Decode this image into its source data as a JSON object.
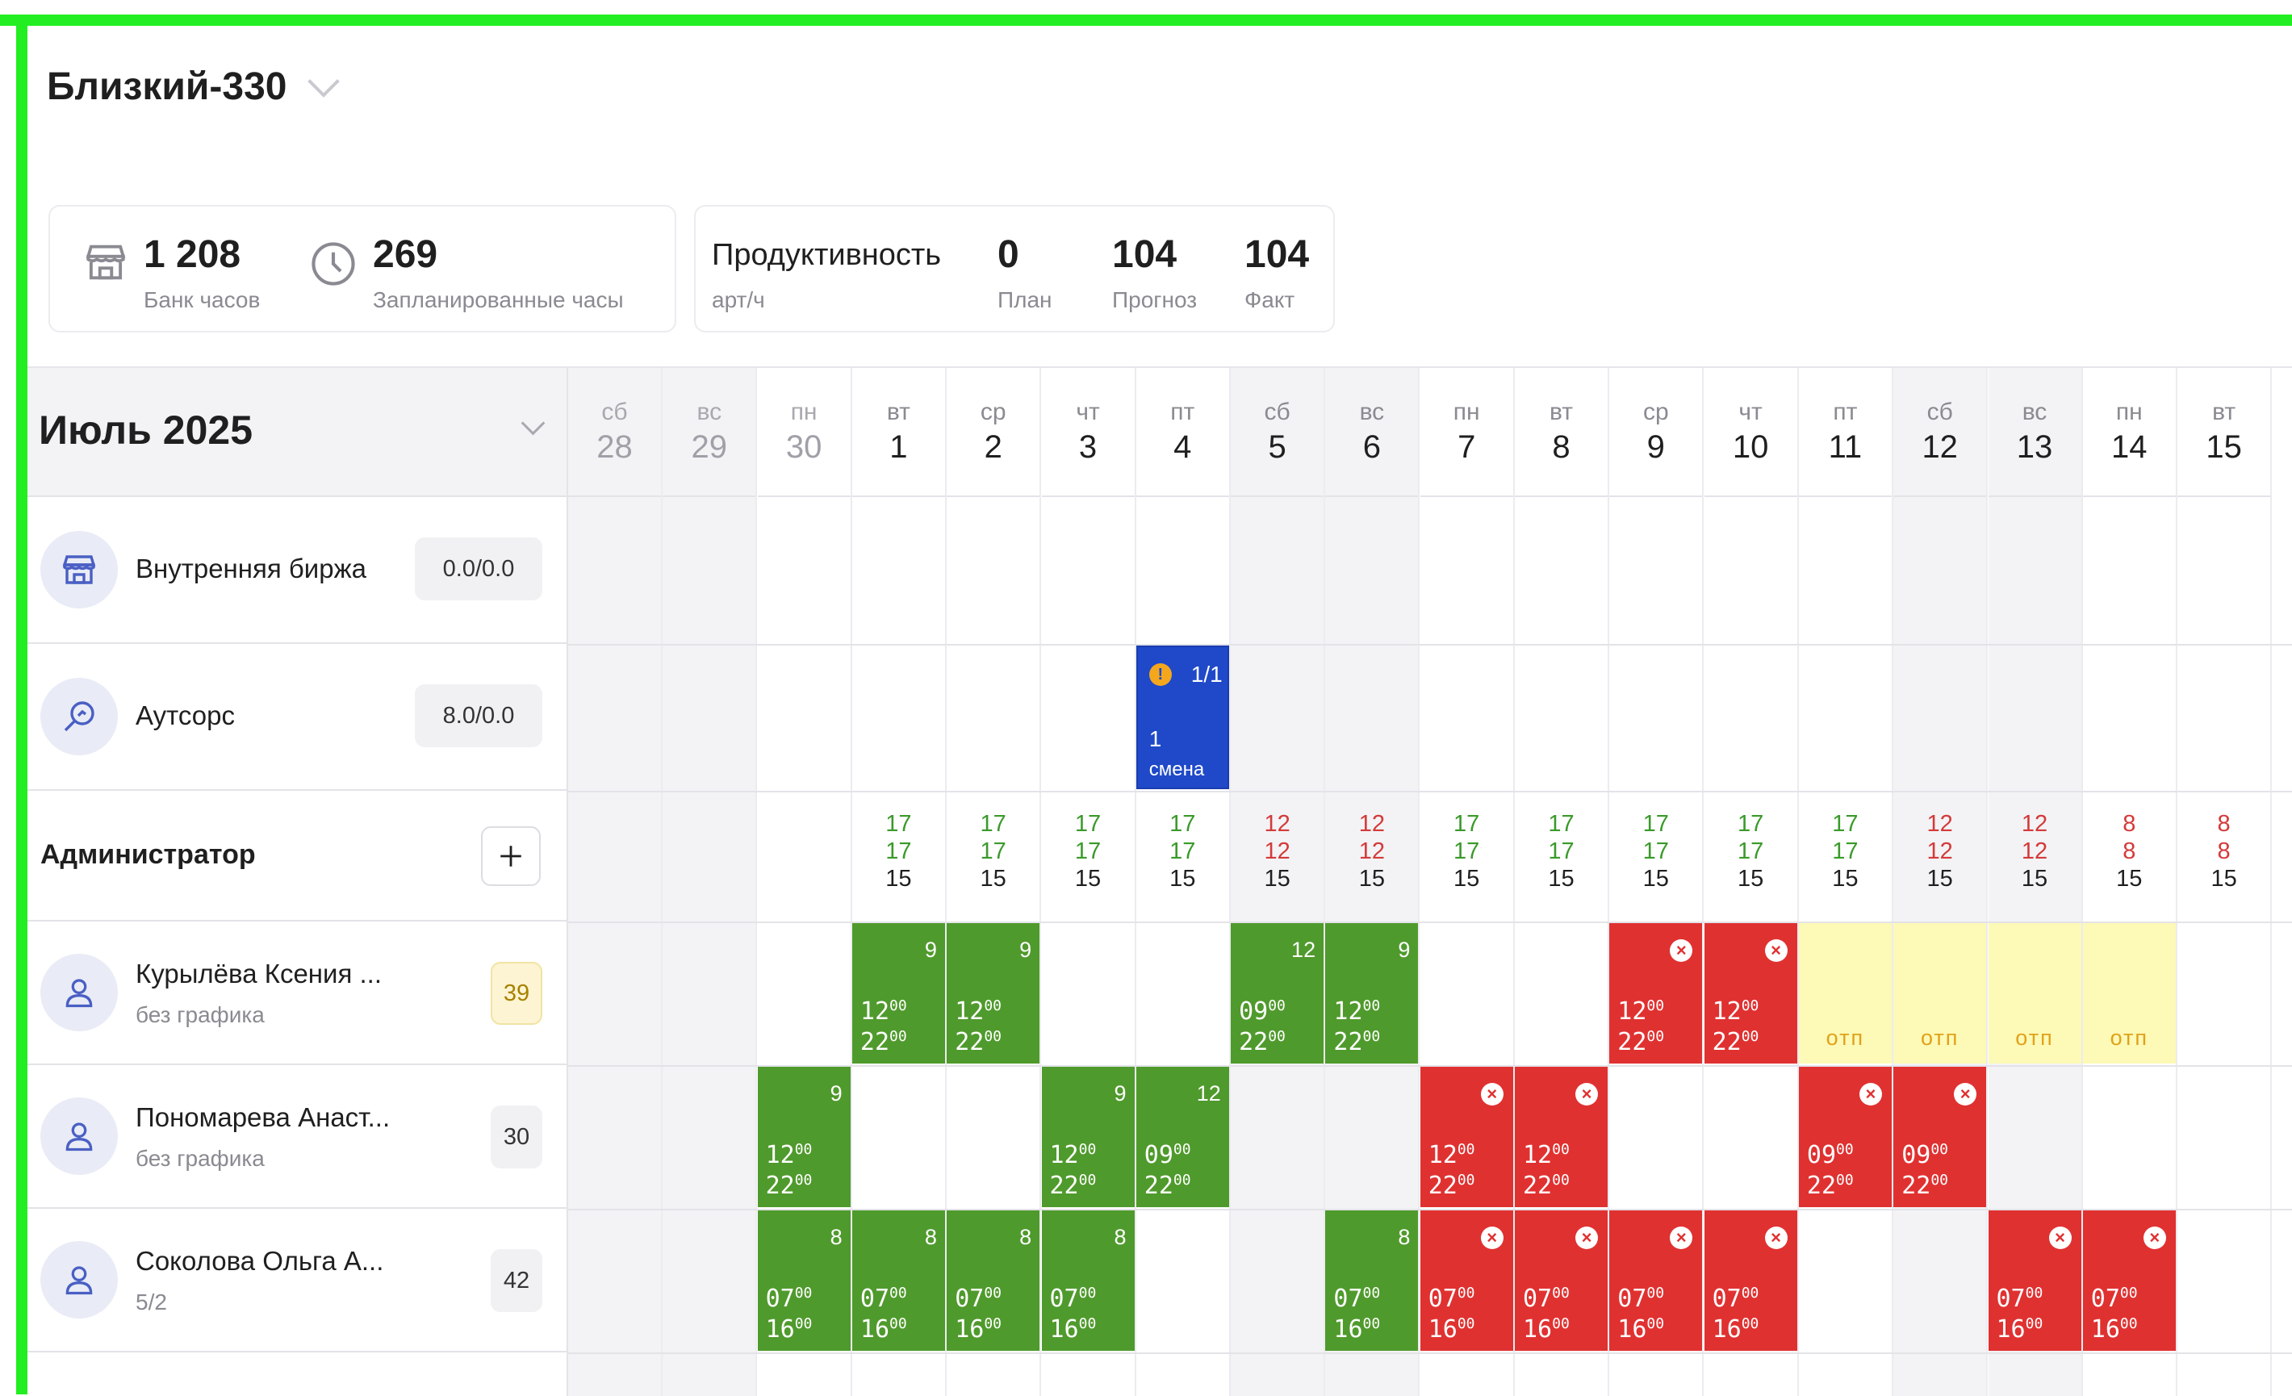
{
  "header": {
    "store_title": "Близкий-330"
  },
  "summary": {
    "bank_hours_value": "1 208",
    "bank_hours_label": "Банк часов",
    "planned_hours_value": "269",
    "planned_hours_label": "Запланированные часы"
  },
  "productivity": {
    "label": "Продуктивность",
    "unit": "арт/ч",
    "plan_value": "0",
    "plan_label": "План",
    "forecast_value": "104",
    "forecast_label": "Прогноз",
    "fact_value": "104",
    "fact_label": "Факт"
  },
  "calendar": {
    "month_label": "Июль 2025",
    "days": [
      {
        "dow": "сб",
        "num": "28"
      },
      {
        "dow": "вс",
        "num": "29"
      },
      {
        "dow": "пн",
        "num": "30"
      },
      {
        "dow": "вт",
        "num": "1"
      },
      {
        "dow": "ср",
        "num": "2"
      },
      {
        "dow": "чт",
        "num": "3"
      },
      {
        "dow": "пт",
        "num": "4"
      },
      {
        "dow": "сб",
        "num": "5"
      },
      {
        "dow": "вс",
        "num": "6"
      },
      {
        "dow": "пн",
        "num": "7"
      },
      {
        "dow": "вт",
        "num": "8"
      },
      {
        "dow": "ср",
        "num": "9"
      },
      {
        "dow": "чт",
        "num": "10"
      },
      {
        "dow": "пт",
        "num": "11"
      },
      {
        "dow": "сб",
        "num": "12"
      },
      {
        "dow": "вс",
        "num": "13"
      },
      {
        "dow": "пн",
        "num": "14"
      },
      {
        "dow": "вт",
        "num": "15"
      }
    ]
  },
  "rows": {
    "exchange": {
      "name": "Внутренняя биржа",
      "value": "0.0/0.0"
    },
    "outsource": {
      "name": "Аутсорс",
      "value": "8.0/0.0",
      "block": {
        "ratio": "1/1",
        "count": "1",
        "label": "смена"
      }
    },
    "role": {
      "title": "Администратор",
      "stats": [
        {
          "a": "17",
          "b": "17",
          "c": "15",
          "color": "green"
        },
        {
          "a": "17",
          "b": "17",
          "c": "15",
          "color": "green"
        },
        {
          "a": "17",
          "b": "17",
          "c": "15",
          "color": "green"
        },
        {
          "a": "17",
          "b": "17",
          "c": "15",
          "color": "green"
        },
        {
          "a": "12",
          "b": "12",
          "c": "15",
          "color": "red"
        },
        {
          "a": "12",
          "b": "12",
          "c": "15",
          "color": "red"
        },
        {
          "a": "17",
          "b": "17",
          "c": "15",
          "color": "green"
        },
        {
          "a": "17",
          "b": "17",
          "c": "15",
          "color": "green"
        },
        {
          "a": "17",
          "b": "17",
          "c": "15",
          "color": "green"
        },
        {
          "a": "17",
          "b": "17",
          "c": "15",
          "color": "green"
        },
        {
          "a": "17",
          "b": "17",
          "c": "15",
          "color": "green"
        },
        {
          "a": "12",
          "b": "12",
          "c": "15",
          "color": "red"
        },
        {
          "a": "12",
          "b": "12",
          "c": "15",
          "color": "red"
        },
        {
          "a": "8",
          "b": "8",
          "c": "15",
          "color": "red"
        },
        {
          "a": "8",
          "b": "8",
          "c": "15",
          "color": "red"
        }
      ]
    },
    "employees": [
      {
        "name": "Курылёва Ксения ...",
        "schedule": "без графика",
        "hours": "39",
        "shifts": [
          {
            "day": 4,
            "type": "green",
            "hours": "9",
            "start": "12",
            "end": "22"
          },
          {
            "day": 5,
            "type": "green",
            "hours": "9",
            "start": "12",
            "end": "22"
          },
          {
            "day": 8,
            "type": "green",
            "hours": "12",
            "start": "09",
            "end": "22"
          },
          {
            "day": 9,
            "type": "green",
            "hours": "9",
            "start": "12",
            "end": "22"
          },
          {
            "day": 12,
            "type": "red",
            "start": "12",
            "end": "22"
          },
          {
            "day": 13,
            "type": "red",
            "start": "12",
            "end": "22"
          },
          {
            "day": 14,
            "type": "yellow",
            "label": "отп"
          },
          {
            "day": 15,
            "type": "yellow",
            "label": "отп"
          },
          {
            "day": 16,
            "type": "yellow",
            "label": "отп"
          },
          {
            "day": 17,
            "type": "yellow",
            "label": "отп"
          }
        ]
      },
      {
        "name": "Пономарева Анаст...",
        "schedule": "без графика",
        "hours": "30",
        "shifts": [
          {
            "day": 3,
            "type": "green",
            "hours": "9",
            "start": "12",
            "end": "22"
          },
          {
            "day": 6,
            "type": "green",
            "hours": "9",
            "start": "12",
            "end": "22"
          },
          {
            "day": 7,
            "type": "green",
            "hours": "12",
            "start": "09",
            "end": "22"
          },
          {
            "day": 10,
            "type": "red",
            "start": "12",
            "end": "22"
          },
          {
            "day": 11,
            "type": "red",
            "start": "12",
            "end": "22"
          },
          {
            "day": 14,
            "type": "red",
            "start": "09",
            "end": "22"
          },
          {
            "day": 15,
            "type": "red",
            "start": "09",
            "end": "22"
          }
        ]
      },
      {
        "name": "Соколова Ольга А...",
        "schedule": "5/2",
        "hours": "42",
        "shifts": [
          {
            "day": 3,
            "type": "green",
            "hours": "8",
            "start": "07",
            "end": "16"
          },
          {
            "day": 4,
            "type": "green",
            "hours": "8",
            "start": "07",
            "end": "16"
          },
          {
            "day": 5,
            "type": "green",
            "hours": "8",
            "start": "07",
            "end": "16"
          },
          {
            "day": 6,
            "type": "green",
            "hours": "8",
            "start": "07",
            "end": "16"
          },
          {
            "day": 9,
            "type": "green",
            "hours": "8",
            "start": "07",
            "end": "16"
          },
          {
            "day": 10,
            "type": "red",
            "start": "07",
            "end": "16"
          },
          {
            "day": 11,
            "type": "red",
            "start": "07",
            "end": "16"
          },
          {
            "day": 12,
            "type": "red",
            "start": "07",
            "end": "16"
          },
          {
            "day": 13,
            "type": "red",
            "start": "07",
            "end": "16"
          },
          {
            "day": 16,
            "type": "red",
            "start": "07",
            "end": "16"
          },
          {
            "day": 17,
            "type": "red",
            "start": "07",
            "end": "16"
          }
        ]
      }
    ]
  },
  "minutes_sup": "00",
  "colors": {
    "work": "#4f9a2c",
    "absent": "#e03131",
    "vacation": "#fdf9b6",
    "outsource": "#1f49c8",
    "frame": "#22ee22"
  }
}
